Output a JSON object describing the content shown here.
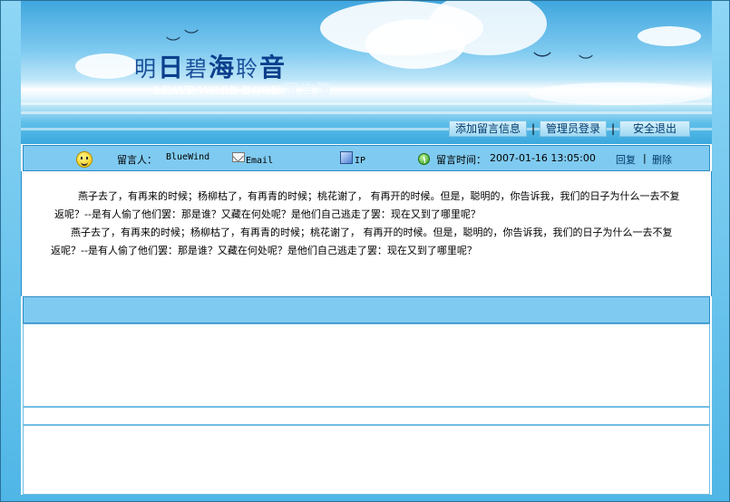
{
  "banner": {
    "logo_title_parts": [
      "明",
      "日",
      "碧",
      "海",
      "聆",
      "音"
    ],
    "logo_subtitle_en": "LEAVE WORD BOOK",
    "logo_subtitle_cn": "留言簿"
  },
  "nav": {
    "items": [
      {
        "label": "添加留言信息"
      },
      {
        "label": "管理员登录"
      },
      {
        "label": "安全退出"
      }
    ],
    "separator": "|"
  },
  "message": {
    "author_label": "留言人：",
    "author_name": "BlueWind",
    "email_label": "Email",
    "ip_label": "IP",
    "time_label": "留言时间：",
    "time_value": "2007-01-16 13:05:00",
    "reply_label": "回复",
    "action_separator": "|",
    "delete_label": "删除",
    "paragraphs": [
      "燕子去了，有再来的时候；杨柳枯了，有再青的时候；桃花谢了， 有再开的时候。但是，聪明的，你告诉我，我们的日子为什么一去不复返呢？--是有人偷了他们罢：那是谁？又藏在何处呢？是他们自己逃走了罢：现在又到了哪里呢？",
      "燕子去了，有再来的时候；杨柳枯了，有再青的时候；桃花谢了， 有再开的时候。但是，聪明的，你告诉我，我们的日子为什么一去不复返呢？--是有人偷了他们罢：那是谁？又藏在何处呢？是他们自己逃走了罢：现在又到了哪里呢？"
    ]
  },
  "colors": {
    "bar_bg": "#7fcaf0",
    "border": "#2b8cc4",
    "outer_bg": "#6fc4ec"
  }
}
